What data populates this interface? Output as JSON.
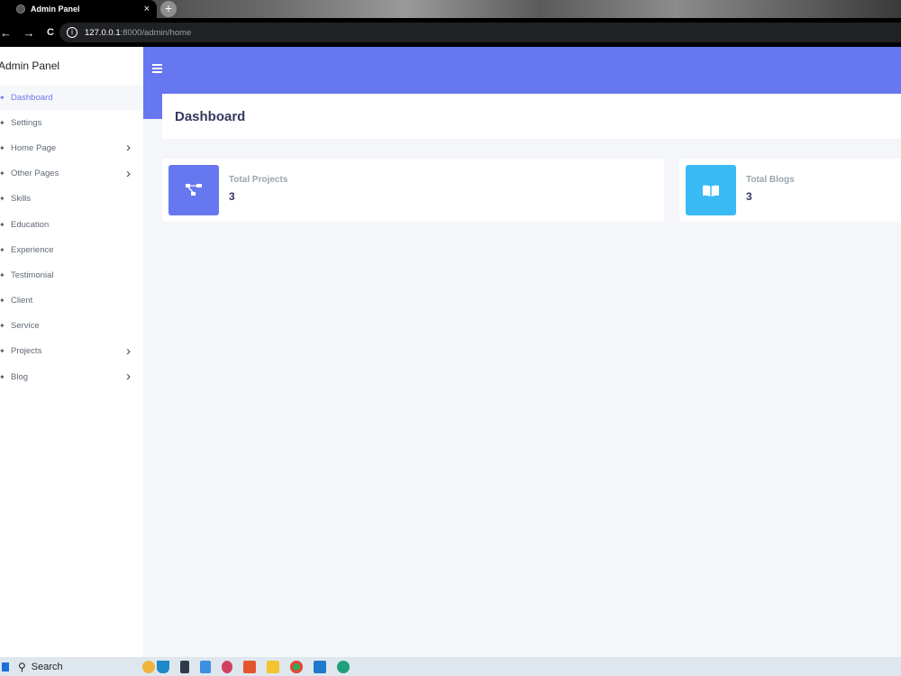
{
  "browser": {
    "tab_title": "Admin Panel",
    "tab_close": "×",
    "new_tab": "+",
    "nav_back": "←",
    "nav_forward": "→",
    "nav_reload": "C",
    "url_host": "127.0.0.1",
    "url_rest": ":8000/admin/home"
  },
  "sidebar": {
    "brand": "Admin Panel",
    "items": [
      {
        "label": "Dashboard",
        "active": true,
        "has_children": false
      },
      {
        "label": "Settings",
        "active": false,
        "has_children": false
      },
      {
        "label": "Home Page",
        "active": false,
        "has_children": true
      },
      {
        "label": "Other Pages",
        "active": false,
        "has_children": true
      },
      {
        "label": "Skills",
        "active": false,
        "has_children": false
      },
      {
        "label": "Education",
        "active": false,
        "has_children": false
      },
      {
        "label": "Experience",
        "active": false,
        "has_children": false
      },
      {
        "label": "Testimonial",
        "active": false,
        "has_children": false
      },
      {
        "label": "Client",
        "active": false,
        "has_children": false
      },
      {
        "label": "Service",
        "active": false,
        "has_children": false
      },
      {
        "label": "Projects",
        "active": false,
        "has_children": true
      },
      {
        "label": "Blog",
        "active": false,
        "has_children": true
      }
    ]
  },
  "page": {
    "title": "Dashboard"
  },
  "stats": [
    {
      "label": "Total Projects",
      "value": "3",
      "color": "#6777ef",
      "icon": "project-diagram-icon"
    },
    {
      "label": "Total Blogs",
      "value": "3",
      "color": "#3abaf4",
      "icon": "book-open-icon"
    }
  ],
  "taskbar": {
    "search_label": "Search"
  },
  "colors": {
    "primary": "#6777ef",
    "info": "#3abaf4",
    "background": "#f4f6f9"
  }
}
